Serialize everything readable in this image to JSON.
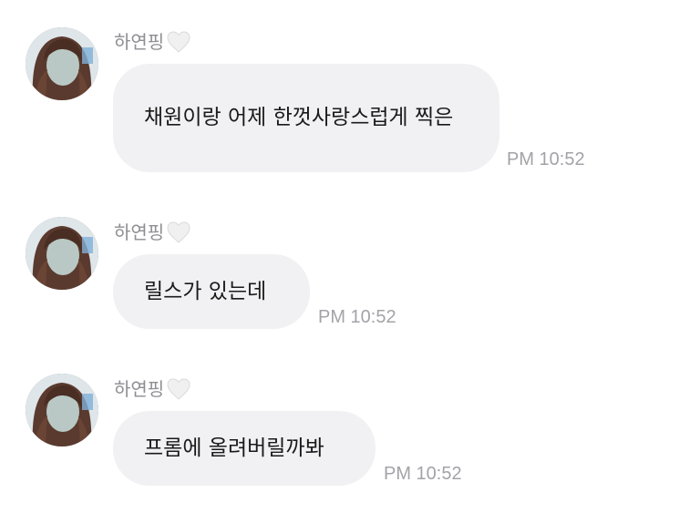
{
  "messages": [
    {
      "sender": "하연핑",
      "heart_emoji": "white-heart",
      "text": "채원이랑 어제 한껏사랑스럽게 찍은",
      "time": "PM 10:52"
    },
    {
      "sender": "하연핑",
      "heart_emoji": "white-heart",
      "text": "릴스가 있는데",
      "time": "PM 10:52"
    },
    {
      "sender": "하연핑",
      "heart_emoji": "white-heart",
      "text": "프롬에 올려버릴까봐",
      "time": "PM 10:52"
    }
  ],
  "colors": {
    "bubble": "#f1f1f3",
    "name": "#8e8e93",
    "time": "#a3a3a8",
    "text": "#1a1a1a"
  }
}
